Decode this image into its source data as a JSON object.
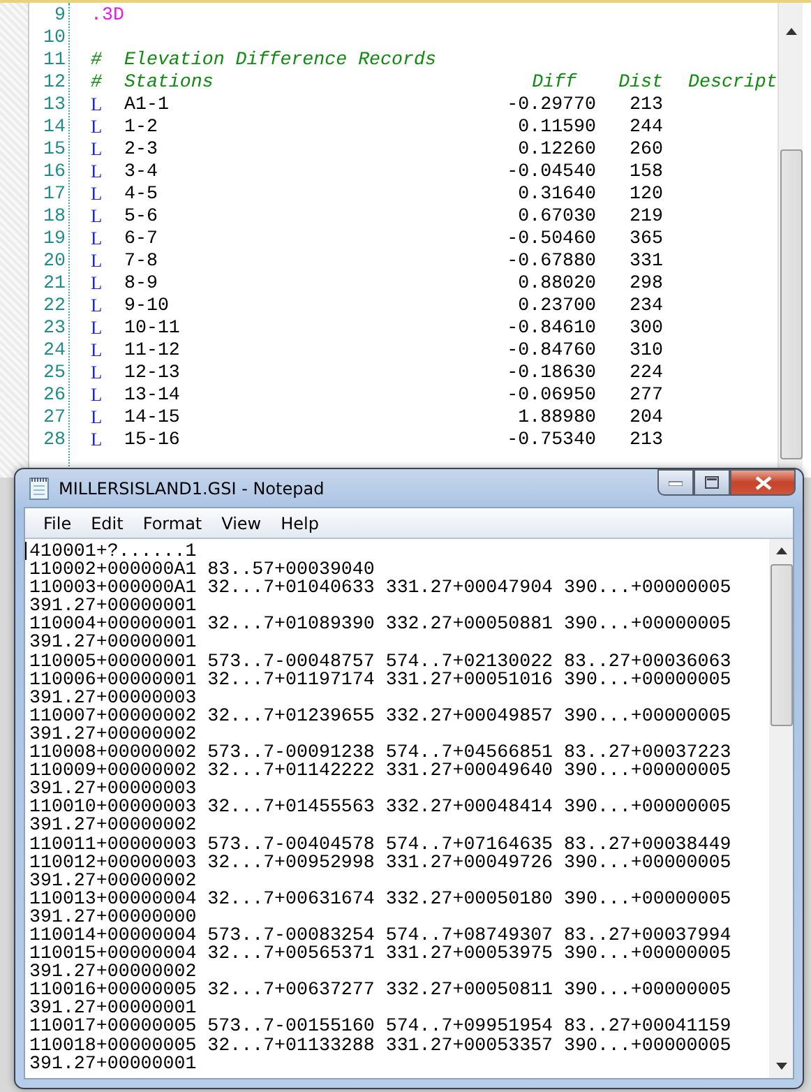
{
  "editor": {
    "lines": [
      {
        "number": "9",
        "kind": "directive",
        "text": ".3D"
      },
      {
        "number": "10",
        "kind": "blank"
      },
      {
        "number": "11",
        "kind": "comment",
        "mark": "#",
        "text": "Elevation Difference Records"
      },
      {
        "number": "12",
        "kind": "header",
        "mark": "#",
        "columns": [
          "Stations",
          "Diff",
          "Dist",
          "Descript"
        ]
      },
      {
        "number": "13",
        "kind": "record",
        "type": "L",
        "station": "A1-1",
        "diff": "-0.29770",
        "dist": "213"
      },
      {
        "number": "14",
        "kind": "record",
        "type": "L",
        "station": "1-2",
        "diff": "0.11590",
        "dist": "244"
      },
      {
        "number": "15",
        "kind": "record",
        "type": "L",
        "station": "2-3",
        "diff": "0.12260",
        "dist": "260"
      },
      {
        "number": "16",
        "kind": "record",
        "type": "L",
        "station": "3-4",
        "diff": "-0.04540",
        "dist": "158"
      },
      {
        "number": "17",
        "kind": "record",
        "type": "L",
        "station": "4-5",
        "diff": "0.31640",
        "dist": "120"
      },
      {
        "number": "18",
        "kind": "record",
        "type": "L",
        "station": "5-6",
        "diff": "0.67030",
        "dist": "219"
      },
      {
        "number": "19",
        "kind": "record",
        "type": "L",
        "station": "6-7",
        "diff": "-0.50460",
        "dist": "365"
      },
      {
        "number": "20",
        "kind": "record",
        "type": "L",
        "station": "7-8",
        "diff": "-0.67880",
        "dist": "331"
      },
      {
        "number": "21",
        "kind": "record",
        "type": "L",
        "station": "8-9",
        "diff": "0.88020",
        "dist": "298"
      },
      {
        "number": "22",
        "kind": "record",
        "type": "L",
        "station": "9-10",
        "diff": "0.23700",
        "dist": "234"
      },
      {
        "number": "23",
        "kind": "record",
        "type": "L",
        "station": "10-11",
        "diff": "-0.84610",
        "dist": "300"
      },
      {
        "number": "24",
        "kind": "record",
        "type": "L",
        "station": "11-12",
        "diff": "-0.84760",
        "dist": "310"
      },
      {
        "number": "25",
        "kind": "record",
        "type": "L",
        "station": "12-13",
        "diff": "-0.18630",
        "dist": "224"
      },
      {
        "number": "26",
        "kind": "record",
        "type": "L",
        "station": "13-14",
        "diff": "-0.06950",
        "dist": "277"
      },
      {
        "number": "27",
        "kind": "record",
        "type": "L",
        "station": "14-15",
        "diff": "1.88980",
        "dist": "204"
      },
      {
        "number": "28",
        "kind": "record",
        "type": "L",
        "station": "15-16",
        "diff": "-0.75340",
        "dist": "213"
      }
    ]
  },
  "notepad": {
    "title": "MILLERSISLAND1.GSI - Notepad",
    "menu": [
      "File",
      "Edit",
      "Format",
      "View",
      "Help"
    ],
    "lines": [
      "410001+?......1",
      "110002+000000A1 83..57+00039040",
      "110003+000000A1 32...7+01040633 331.27+00047904 390...+00000005",
      "391.27+00000001",
      "110004+00000001 32...7+01089390 332.27+00050881 390...+00000005",
      "391.27+00000001",
      "110005+00000001 573..7-00048757 574..7+02130022 83..27+00036063",
      "110006+00000001 32...7+01197174 331.27+00051016 390...+00000005",
      "391.27+00000003",
      "110007+00000002 32...7+01239655 332.27+00049857 390...+00000005",
      "391.27+00000002",
      "110008+00000002 573..7-00091238 574..7+04566851 83..27+00037223",
      "110009+00000002 32...7+01142222 331.27+00049640 390...+00000005",
      "391.27+00000003",
      "110010+00000003 32...7+01455563 332.27+00048414 390...+00000005",
      "391.27+00000002",
      "110011+00000003 573..7-00404578 574..7+07164635 83..27+00038449",
      "110012+00000003 32...7+00952998 331.27+00049726 390...+00000005",
      "391.27+00000002",
      "110013+00000004 32...7+00631674 332.27+00050180 390...+00000005",
      "391.27+00000000",
      "110014+00000004 573..7-00083254 574..7+08749307 83..27+00037994",
      "110015+00000004 32...7+00565371 331.27+00053975 390...+00000005",
      "391.27+00000002",
      "110016+00000005 32...7+00637277 332.27+00050811 390...+00000005",
      "391.27+00000001",
      "110017+00000005 573..7-00155160 574..7+09951954 83..27+00041159",
      "110018+00000005 32...7+01133288 331.27+00053357 390...+00000005",
      "391.27+00000001"
    ]
  }
}
